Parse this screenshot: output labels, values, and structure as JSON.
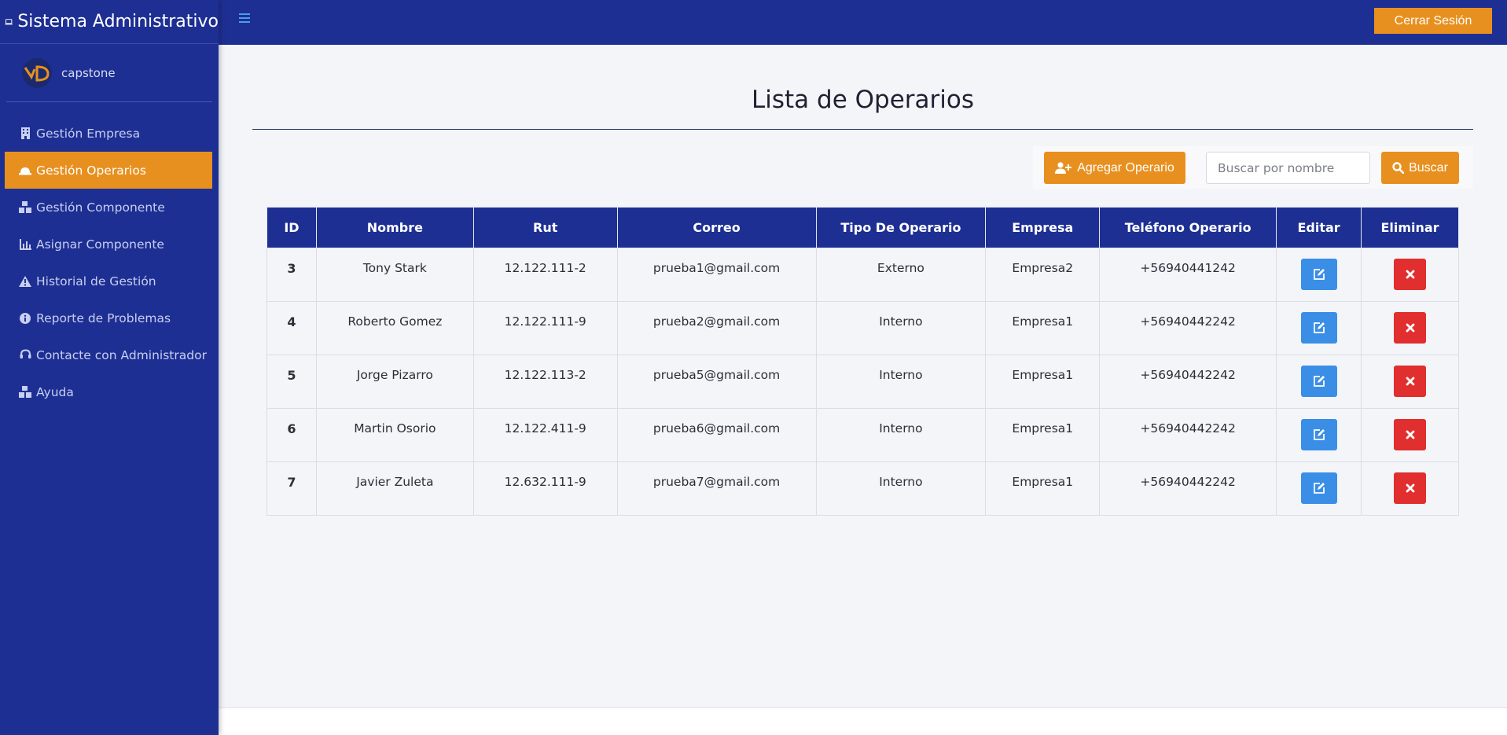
{
  "app": {
    "title": "Sistema Administrativo"
  },
  "user": {
    "name": "capstone"
  },
  "sidebar": {
    "items": [
      {
        "label": "Gestión Empresa",
        "icon": "building-icon"
      },
      {
        "label": "Gestión Operarios",
        "icon": "hard-hat-icon",
        "active": true
      },
      {
        "label": "Gestión Componente",
        "icon": "boxes-icon"
      },
      {
        "label": "Asignar Componente",
        "icon": "chart-icon"
      },
      {
        "label": "Historial de Gestión",
        "icon": "warning-icon"
      },
      {
        "label": "Reporte de Problemas",
        "icon": "info-icon"
      },
      {
        "label": "Contacte con Administrador",
        "icon": "headset-icon"
      },
      {
        "label": "Ayuda",
        "icon": "boxes-icon"
      }
    ]
  },
  "topbar": {
    "logout_label": "Cerrar Sesión",
    "menu_icon": "hamburger-icon"
  },
  "page": {
    "title": "Lista de Operarios"
  },
  "toolbar": {
    "add_label": "Agregar Operario",
    "search_placeholder": "Buscar por nombre",
    "search_label": "Buscar"
  },
  "table": {
    "headers": [
      "ID",
      "Nombre",
      "Rut",
      "Correo",
      "Tipo De Operario",
      "Empresa",
      "Teléfono Operario",
      "Editar",
      "Eliminar"
    ],
    "rows": [
      {
        "id": "3",
        "nombre": "Tony Stark",
        "rut": "12.122.111-2",
        "correo": "prueba1@gmail.com",
        "tipo": "Externo",
        "empresa": "Empresa2",
        "telefono": "+56940441242"
      },
      {
        "id": "4",
        "nombre": "Roberto Gomez",
        "rut": "12.122.111-9",
        "correo": "prueba2@gmail.com",
        "tipo": "Interno",
        "empresa": "Empresa1",
        "telefono": "+56940442242"
      },
      {
        "id": "5",
        "nombre": "Jorge Pizarro",
        "rut": "12.122.113-2",
        "correo": "prueba5@gmail.com",
        "tipo": "Interno",
        "empresa": "Empresa1",
        "telefono": "+56940442242"
      },
      {
        "id": "6",
        "nombre": "Martin Osorio",
        "rut": "12.122.411-9",
        "correo": "prueba6@gmail.com",
        "tipo": "Interno",
        "empresa": "Empresa1",
        "telefono": "+56940442242"
      },
      {
        "id": "7",
        "nombre": "Javier Zuleta",
        "rut": "12.632.111-9",
        "correo": "prueba7@gmail.com",
        "tipo": "Interno",
        "empresa": "Empresa1",
        "telefono": "+56940442242"
      }
    ]
  },
  "colors": {
    "primary": "#1e2f93",
    "accent": "#e8901f",
    "edit": "#3a8ee6",
    "delete": "#e12e2e"
  }
}
